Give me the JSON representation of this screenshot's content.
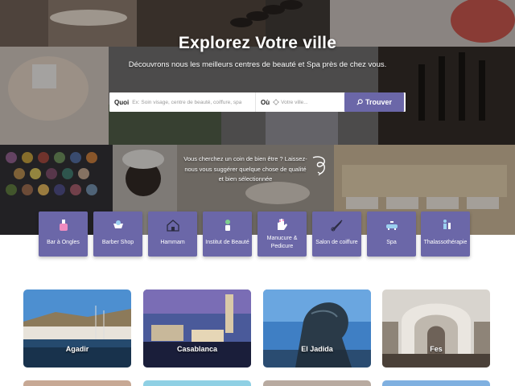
{
  "hero": {
    "title": "Explorez Votre ville",
    "subtitle": "Découvrons nous les meilleurs centres de beauté et Spa près de chez vous."
  },
  "search": {
    "what_label": "Quoi",
    "what_placeholder": "Ex: Soin visage, centre de beauté, coiffure, spa",
    "where_label": "Où",
    "where_placeholder": "Votre ville...",
    "button_label": "Trouver"
  },
  "quote": {
    "line1": "Vous cherchez un coin de bien être ? Laissez-",
    "line2": "nous vous suggérer quelque chose de qualité",
    "line3": "et bien sélectionnée"
  },
  "categories": [
    {
      "label": "Bar à Ongles",
      "icon": "nail-polish-icon"
    },
    {
      "label": "Barber Shop",
      "icon": "barber-icon"
    },
    {
      "label": "Hammam",
      "icon": "hammam-icon"
    },
    {
      "label": "Institut de Beauté",
      "icon": "beauty-institute-icon"
    },
    {
      "label": "Manucure & Pedicure",
      "icon": "manicure-icon"
    },
    {
      "label": "Salon de coiffure",
      "icon": "scissors-icon"
    },
    {
      "label": "Spa",
      "icon": "spa-tub-icon"
    },
    {
      "label": "Thalassothérapie",
      "icon": "thalasso-icon"
    }
  ],
  "cities": [
    {
      "name": "Agadir"
    },
    {
      "name": "Casablanca"
    },
    {
      "name": "El Jadida"
    },
    {
      "name": "Fes"
    }
  ],
  "colors": {
    "accent": "#6b67a8",
    "white": "#ffffff"
  }
}
